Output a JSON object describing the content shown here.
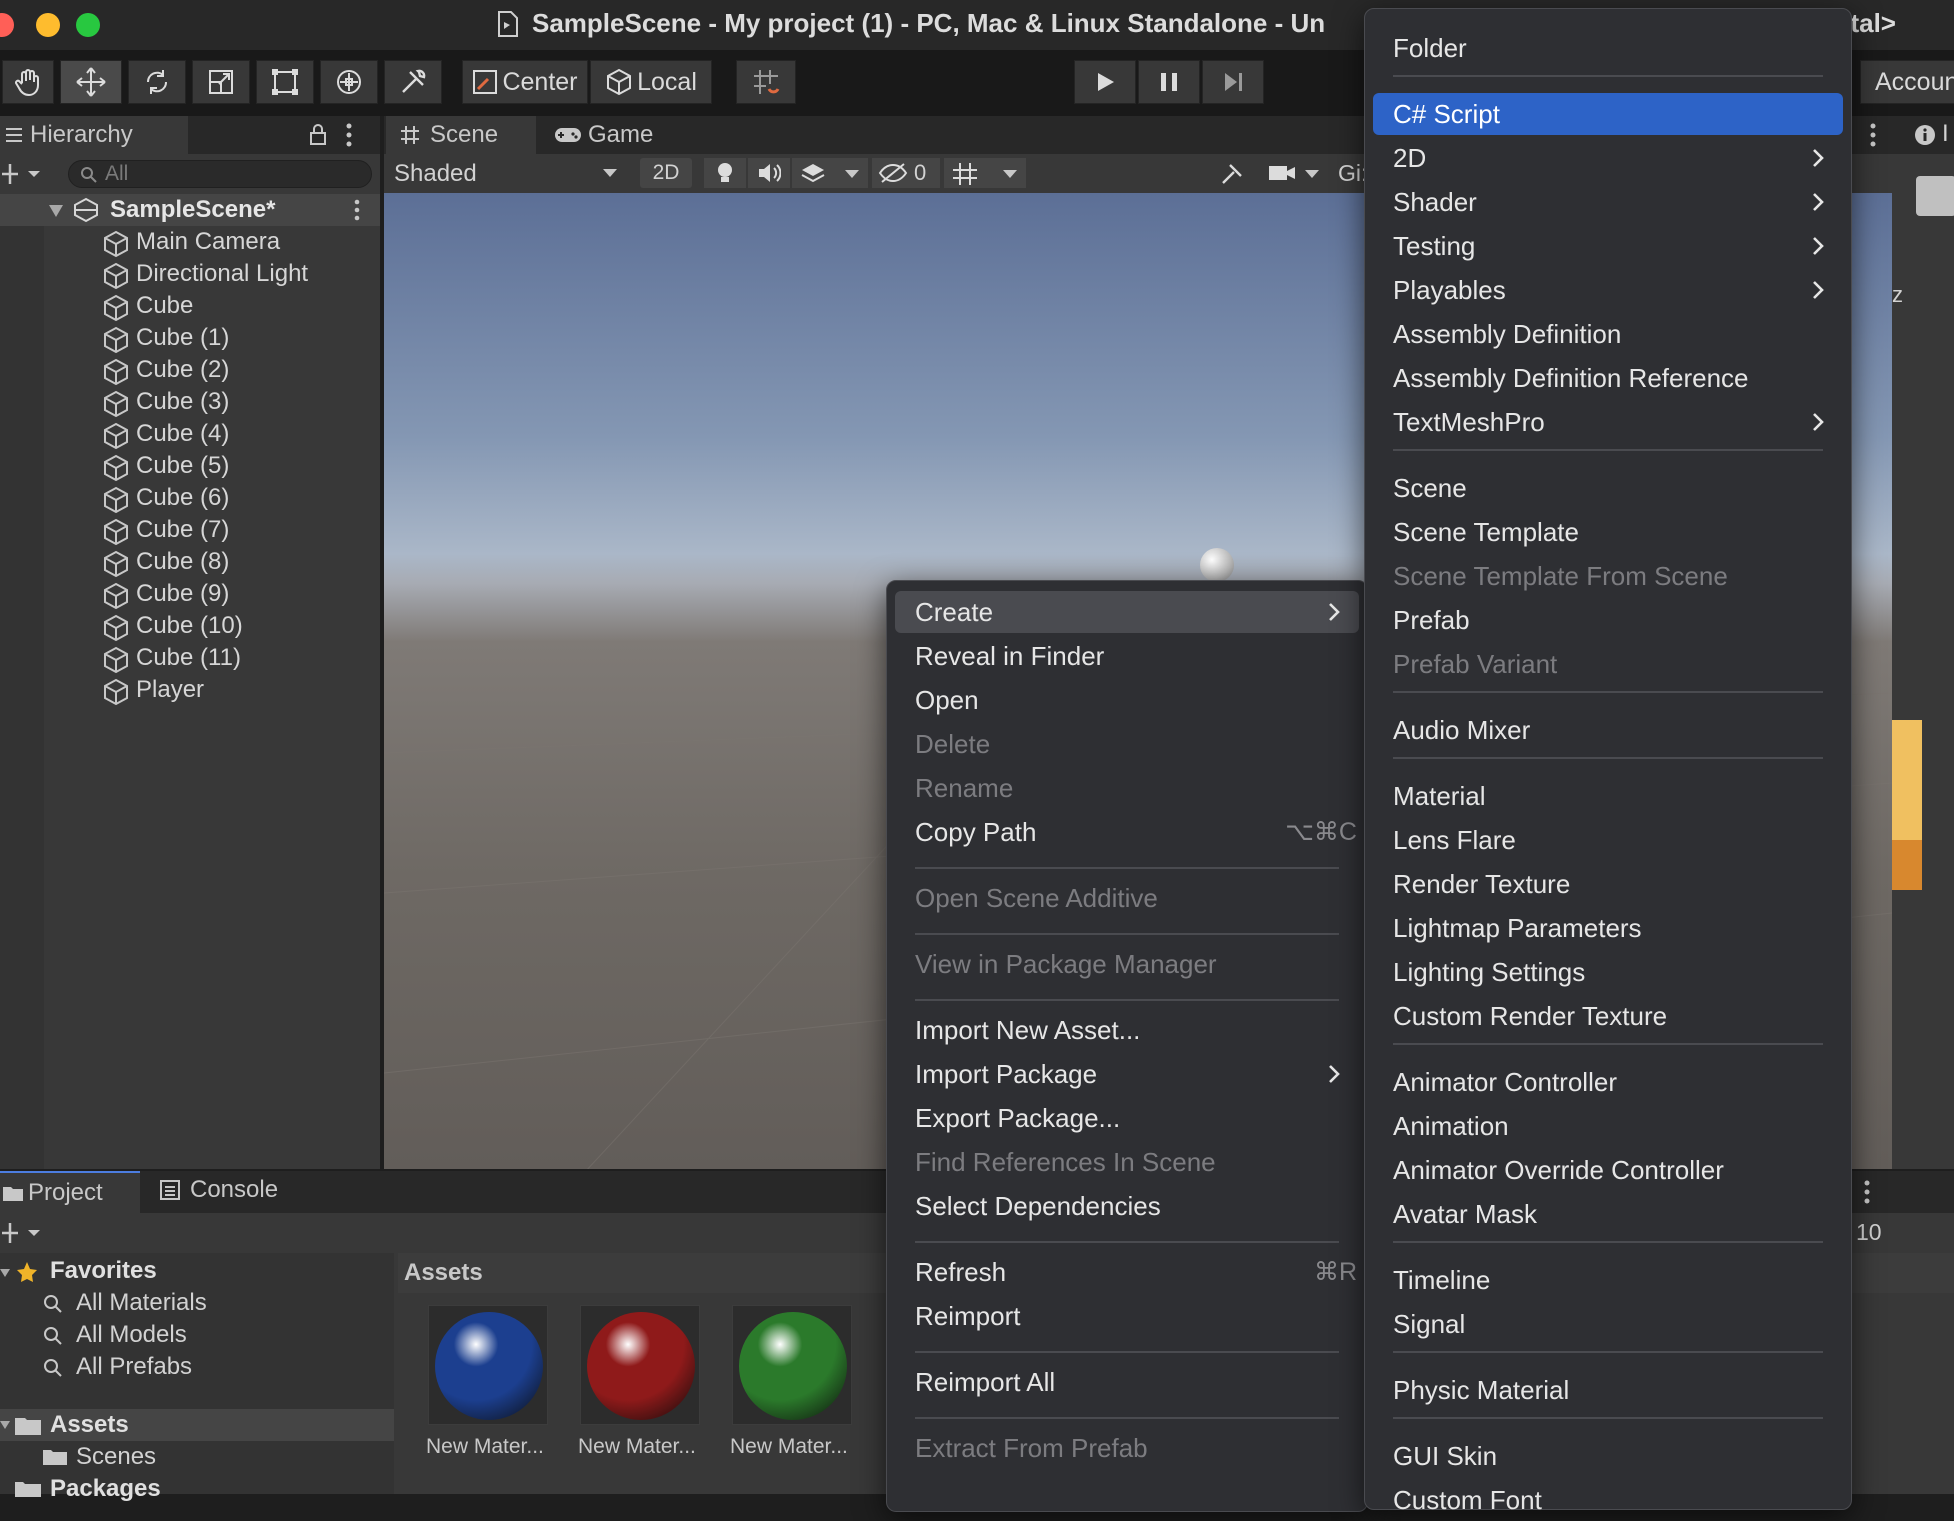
{
  "window": {
    "title": "SampleScene - My project (1) - PC, Mac & Linux Standalone - Un",
    "title_suffix": "etal>"
  },
  "colors": {
    "close": "#ff5f57",
    "minimize": "#febc2e",
    "zoom": "#28c840",
    "highlight": "#2d63c7",
    "panel": "#383838"
  },
  "toolbar": {
    "center_label": "Center",
    "local_label": "Local",
    "account_label": "Accoun"
  },
  "hierarchy": {
    "tab_label": "Hierarchy",
    "search_placeholder": "All",
    "scene_name": "SampleScene*",
    "items": [
      "Main Camera",
      "Directional Light",
      "Cube",
      "Cube (1)",
      "Cube (2)",
      "Cube (3)",
      "Cube (4)",
      "Cube (5)",
      "Cube (6)",
      "Cube (7)",
      "Cube (8)",
      "Cube (9)",
      "Cube (10)",
      "Cube (11)",
      "Player"
    ]
  },
  "scene_view": {
    "tabs": [
      "Scene",
      "Game"
    ],
    "shading_mode": "Shaded",
    "mode_2d": "2D",
    "hidden_count": "0",
    "gizmos_label": "Gi:"
  },
  "inspector": {
    "tab_label": "I",
    "axis_label": "z",
    "right_count": "10"
  },
  "project": {
    "tabs": [
      "Project",
      "Console"
    ],
    "favorites_label": "Favorites",
    "favorites": [
      "All Materials",
      "All Models",
      "All Prefabs"
    ],
    "assets_label": "Assets",
    "asset_folders": [
      "Scenes"
    ],
    "packages_label": "Packages",
    "breadcrumb": "Assets",
    "assets": [
      {
        "label": "New Mater...",
        "color": "#1c3f8f"
      },
      {
        "label": "New Mater...",
        "color": "#8f1a1a"
      },
      {
        "label": "New Mater...",
        "color": "#2b7a2b"
      }
    ]
  },
  "context_menu": {
    "items": [
      {
        "label": "Create",
        "submenu": true,
        "state": "hover"
      },
      {
        "label": "Reveal in Finder"
      },
      {
        "label": "Open"
      },
      {
        "label": "Delete",
        "disabled": true
      },
      {
        "label": "Rename",
        "disabled": true
      },
      {
        "label": "Copy Path",
        "shortcut": "⌥⌘C"
      },
      {
        "label": "Open Scene Additive",
        "disabled": true
      },
      {
        "label": "View in Package Manager",
        "disabled": true
      },
      {
        "label": "Import New Asset..."
      },
      {
        "label": "Import Package",
        "submenu": true
      },
      {
        "label": "Export Package..."
      },
      {
        "label": "Find References In Scene",
        "disabled": true
      },
      {
        "label": "Select Dependencies"
      },
      {
        "label": "Refresh",
        "shortcut": "⌘R"
      },
      {
        "label": "Reimport"
      },
      {
        "label": "Reimport All"
      },
      {
        "label": "Extract From Prefab",
        "disabled": true
      }
    ]
  },
  "create_submenu": {
    "items": [
      {
        "label": "Folder"
      },
      {
        "label": "C# Script",
        "state": "selected"
      },
      {
        "label": "2D",
        "submenu": true
      },
      {
        "label": "Shader",
        "submenu": true
      },
      {
        "label": "Testing",
        "submenu": true
      },
      {
        "label": "Playables",
        "submenu": true
      },
      {
        "label": "Assembly Definition"
      },
      {
        "label": "Assembly Definition Reference"
      },
      {
        "label": "TextMeshPro",
        "submenu": true
      },
      {
        "label": "Scene"
      },
      {
        "label": "Scene Template"
      },
      {
        "label": "Scene Template From Scene",
        "disabled": true
      },
      {
        "label": "Prefab"
      },
      {
        "label": "Prefab Variant",
        "disabled": true
      },
      {
        "label": "Audio Mixer"
      },
      {
        "label": "Material"
      },
      {
        "label": "Lens Flare"
      },
      {
        "label": "Render Texture"
      },
      {
        "label": "Lightmap Parameters"
      },
      {
        "label": "Lighting Settings"
      },
      {
        "label": "Custom Render Texture"
      },
      {
        "label": "Animator Controller"
      },
      {
        "label": "Animation"
      },
      {
        "label": "Animator Override Controller"
      },
      {
        "label": "Avatar Mask"
      },
      {
        "label": "Timeline"
      },
      {
        "label": "Signal"
      },
      {
        "label": "Physic Material"
      },
      {
        "label": "GUI Skin"
      },
      {
        "label": "Custom Font"
      }
    ]
  }
}
